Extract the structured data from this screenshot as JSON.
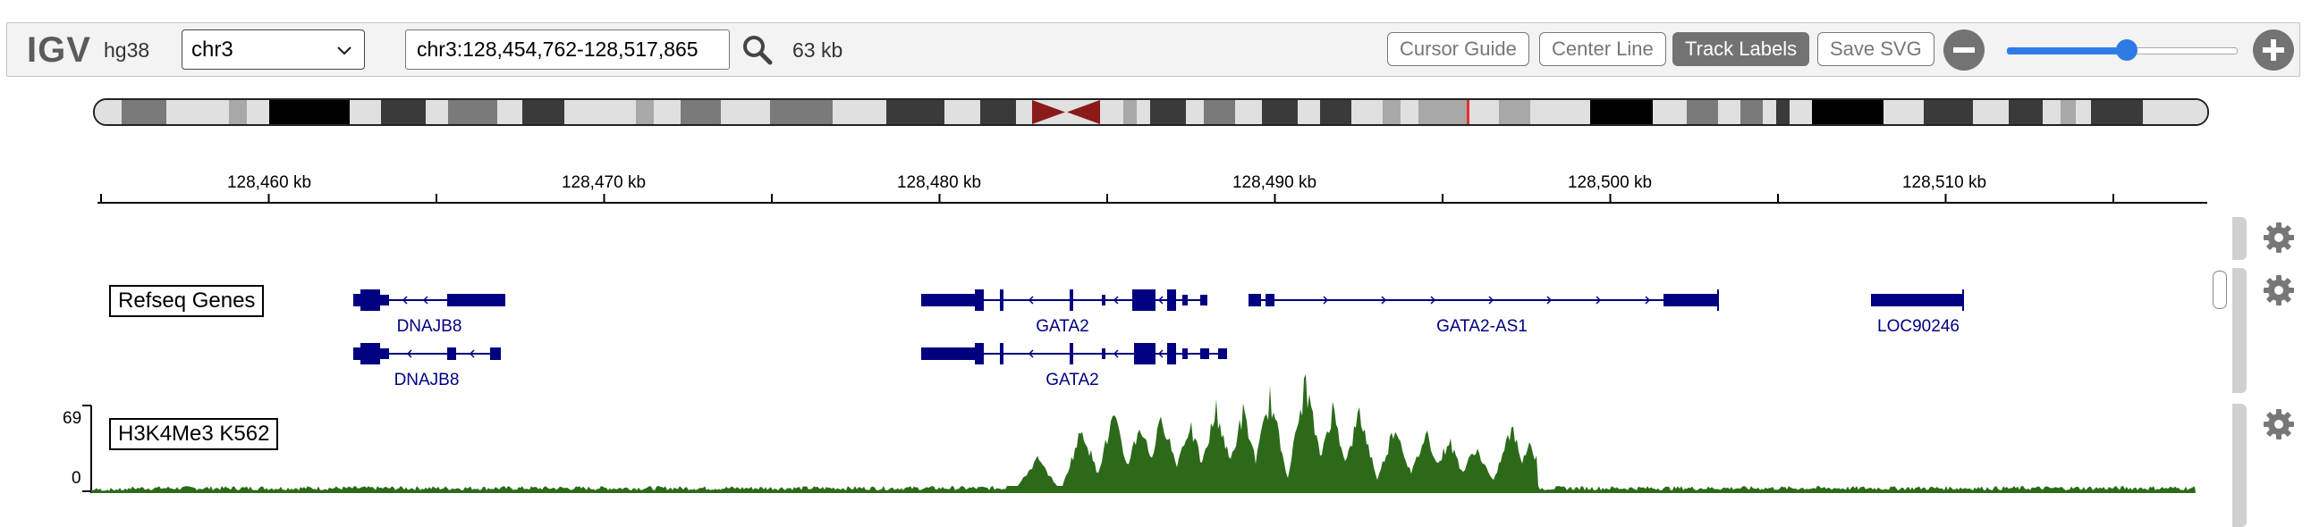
{
  "navbar": {
    "logo": "IGV",
    "genome": "hg38",
    "chromosome": "chr3",
    "locus": "chr3:128,454,762-128,517,865",
    "window_size": "63 kb",
    "buttons": {
      "cursor_guide": "Cursor Guide",
      "center_line": "Center Line",
      "track_labels": "Track Labels",
      "save_svg": "Save SVG"
    },
    "zoom_level": 0.52
  },
  "icons": {
    "search": "search-icon",
    "zoom_out": "minus-circle-icon",
    "zoom_in": "plus-circle-icon",
    "gear": "gear-icon",
    "chevron": "chevron-down-icon"
  },
  "colors": {
    "gene": "#000080",
    "coverage": "#2c6a1a",
    "centromere": "#8b1a1a",
    "current_region": "#e53030",
    "slider": "#2f7be6"
  },
  "ruler": {
    "tick_labels": [
      "128,460 kb",
      "128,470 kb",
      "128,480 kb",
      "128,490 kb",
      "128,500 kb",
      "128,510 kb"
    ]
  },
  "tracks": {
    "refseq": {
      "label": "Refseq Genes",
      "genes": [
        "DNAJB8",
        "DNAJB8",
        "GATA2",
        "GATA2",
        "GATA2-AS1",
        "LOC90246"
      ]
    },
    "h3k4me3": {
      "label": "H3K4Me3 K562",
      "scale_max": "69",
      "scale_min": "0"
    }
  }
}
